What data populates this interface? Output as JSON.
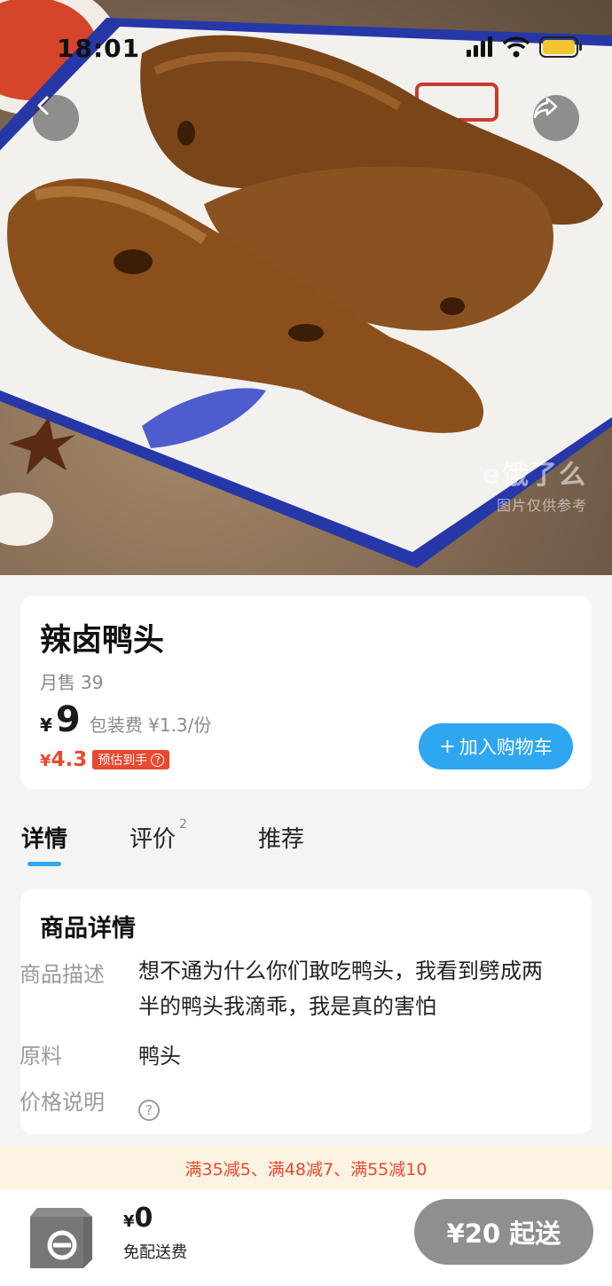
{
  "status_bar": {
    "time": "18:01",
    "icons": [
      "signal-icon",
      "wifi-icon",
      "battery-icon"
    ]
  },
  "hero": {
    "watermark_logo": "e饿了么",
    "watermark_sub": "图片仅供参考"
  },
  "product": {
    "name": "辣卤鸭头",
    "monthly_sales_label": "月售",
    "monthly_sales_value": "39",
    "price_symbol": "¥",
    "price": "9",
    "packaging_fee": "包装费 ¥1.3/份",
    "estimated_symbol": "¥",
    "estimated_price": "4.3",
    "estimated_tag": "预估到手",
    "add_to_cart_plus": "+",
    "add_to_cart": "加入购物车"
  },
  "tabs": [
    {
      "label": "详情",
      "active": true
    },
    {
      "label": "评价",
      "badge": "2"
    },
    {
      "label": "推荐"
    }
  ],
  "details": {
    "title": "商品详情",
    "rows": [
      {
        "label": "商品描述",
        "value": "想不通为什么你们敢吃鸭头，我看到劈成两半的鸭头我滴乖，我是真的害怕"
      },
      {
        "label": "原料",
        "value": "鸭头"
      },
      {
        "label": "价格说明",
        "value": "?"
      }
    ]
  },
  "promo": {
    "text": "满35减5、满48减7、满55减10"
  },
  "bottom_bar": {
    "total_symbol": "¥",
    "total": "0",
    "delivery_note": "免配送费",
    "min_order": "¥20 起送"
  },
  "colors": {
    "accent_blue": "#2fa6f0",
    "price_red": "#e8492f",
    "promo_bg": "#fdf3e2",
    "disabled_gray": "#8f8f8f"
  }
}
